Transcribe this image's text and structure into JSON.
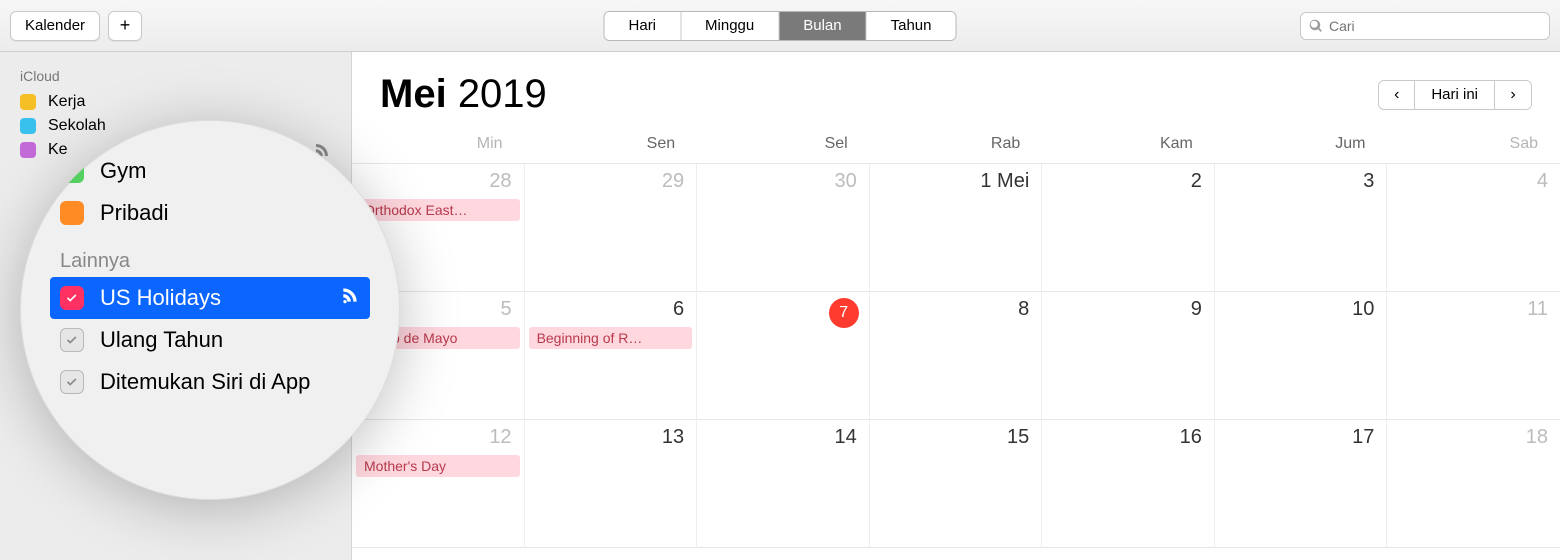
{
  "toolbar": {
    "calendars_label": "Kalender",
    "add_label": "+",
    "views": [
      "Hari",
      "Minggu",
      "Bulan",
      "Tahun"
    ],
    "active_view_index": 2,
    "search_placeholder": "Cari"
  },
  "sidebar": {
    "group1_label": "iCloud",
    "items": [
      {
        "label": "Kerja",
        "color": "#f6bf26"
      },
      {
        "label": "Sekolah",
        "color": "#39c1ee"
      },
      {
        "label": "Ke",
        "color": "#c36bd9",
        "has_feed": true
      }
    ]
  },
  "calendar": {
    "month_label": "Mei",
    "year_label": "2019",
    "today_label": "Hari ini",
    "weekdays": [
      "Min",
      "Sen",
      "Sel",
      "Rab",
      "Kam",
      "Jum",
      "Sab"
    ],
    "weeks": [
      [
        {
          "num": "28",
          "other": true,
          "events": [
            "Orthodox East…"
          ]
        },
        {
          "num": "29",
          "other": true
        },
        {
          "num": "30",
          "other": true
        },
        {
          "num": "1 Mei"
        },
        {
          "num": "2"
        },
        {
          "num": "3"
        },
        {
          "num": "4",
          "weekend": true
        }
      ],
      [
        {
          "num": "5",
          "weekend": true,
          "events": [
            "Cinco de Mayo"
          ]
        },
        {
          "num": "6",
          "events": [
            "Beginning of R…"
          ]
        },
        {
          "num": "7",
          "today": true
        },
        {
          "num": "8"
        },
        {
          "num": "9"
        },
        {
          "num": "10"
        },
        {
          "num": "11",
          "weekend": true
        }
      ],
      [
        {
          "num": "12",
          "weekend": true,
          "events": [
            "Mother's Day"
          ]
        },
        {
          "num": "13"
        },
        {
          "num": "14"
        },
        {
          "num": "15"
        },
        {
          "num": "16"
        },
        {
          "num": "17"
        },
        {
          "num": "18",
          "weekend": true
        }
      ]
    ]
  },
  "lens": {
    "items_top": [
      {
        "label": "Gym",
        "color": "#53d060"
      },
      {
        "label": "Pribadi",
        "color": "#ff8b24"
      }
    ],
    "section_label": "Lainnya",
    "items_other": [
      {
        "label": "US Holidays",
        "checked": true,
        "red": true,
        "selected": true,
        "feed": true
      },
      {
        "label": "Ulang Tahun",
        "checked": true
      },
      {
        "label": "Ditemukan Siri di App",
        "checked": true
      }
    ]
  }
}
